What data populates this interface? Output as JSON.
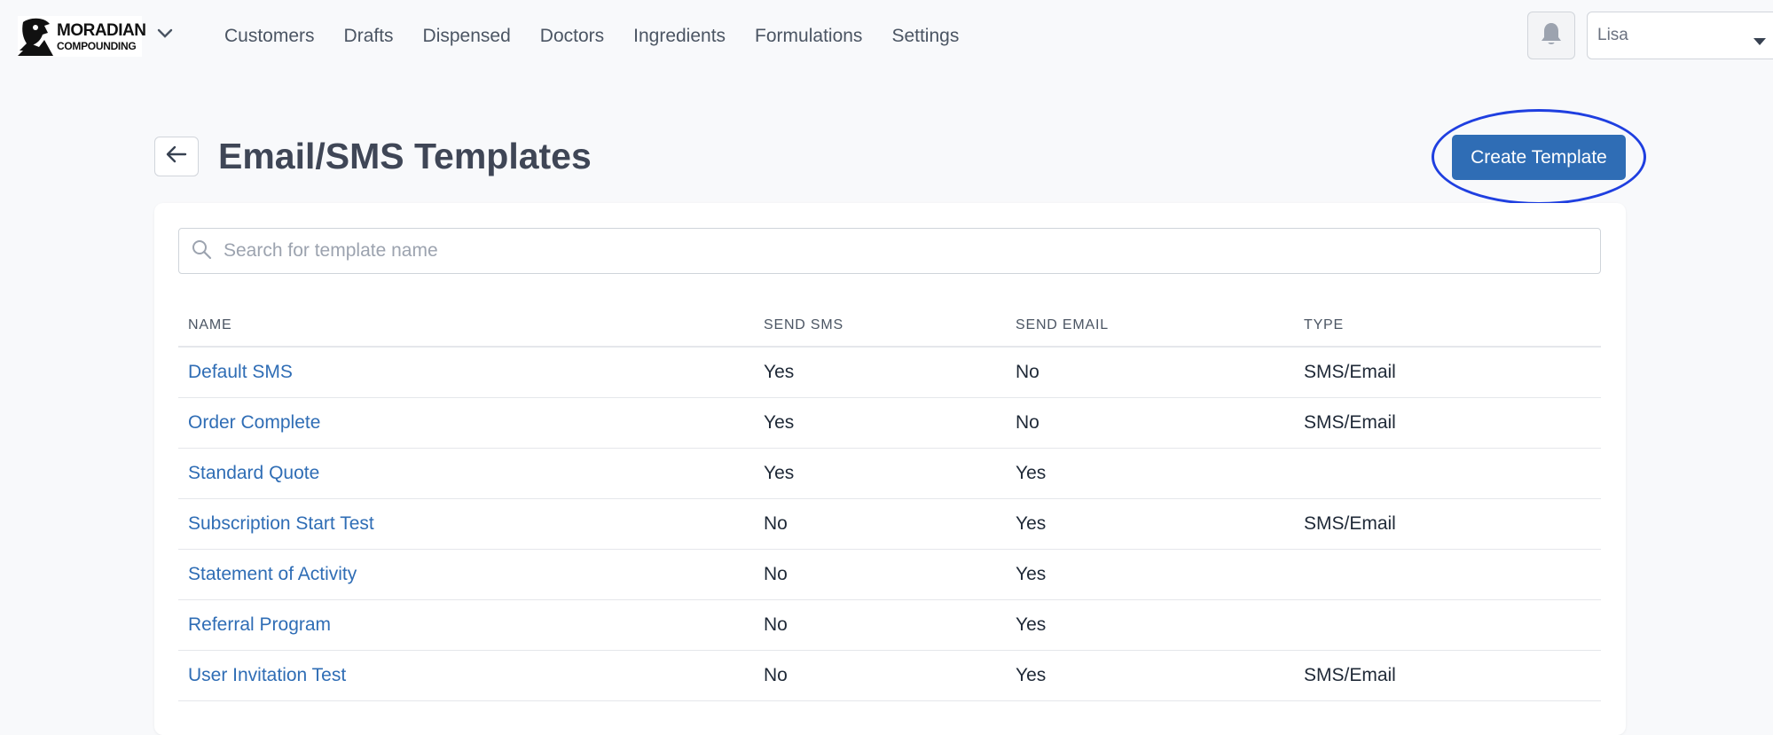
{
  "brand": {
    "line1": "MORADIAN",
    "line2": "COMPOUNDING",
    "accent": "#2f6db5"
  },
  "nav": {
    "items": [
      "Customers",
      "Drafts",
      "Dispensed",
      "Doctors",
      "Ingredients",
      "Formulations",
      "Settings"
    ]
  },
  "user": {
    "name": "Lisa"
  },
  "header": {
    "title": "Email/SMS Templates",
    "create_label": "Create Template"
  },
  "search": {
    "placeholder": "Search for template name",
    "value": ""
  },
  "table": {
    "columns": [
      "NAME",
      "SEND SMS",
      "SEND EMAIL",
      "TYPE"
    ],
    "rows": [
      {
        "name": "Default SMS",
        "send_sms": "Yes",
        "send_email": "No",
        "type": "SMS/Email"
      },
      {
        "name": "Order Complete",
        "send_sms": "Yes",
        "send_email": "No",
        "type": "SMS/Email"
      },
      {
        "name": "Standard Quote",
        "send_sms": "Yes",
        "send_email": "Yes",
        "type": ""
      },
      {
        "name": "Subscription Start Test",
        "send_sms": "No",
        "send_email": "Yes",
        "type": "SMS/Email"
      },
      {
        "name": "Statement of Activity",
        "send_sms": "No",
        "send_email": "Yes",
        "type": ""
      },
      {
        "name": "Referral Program",
        "send_sms": "No",
        "send_email": "Yes",
        "type": ""
      },
      {
        "name": "User Invitation Test",
        "send_sms": "No",
        "send_email": "Yes",
        "type": "SMS/Email"
      }
    ]
  }
}
